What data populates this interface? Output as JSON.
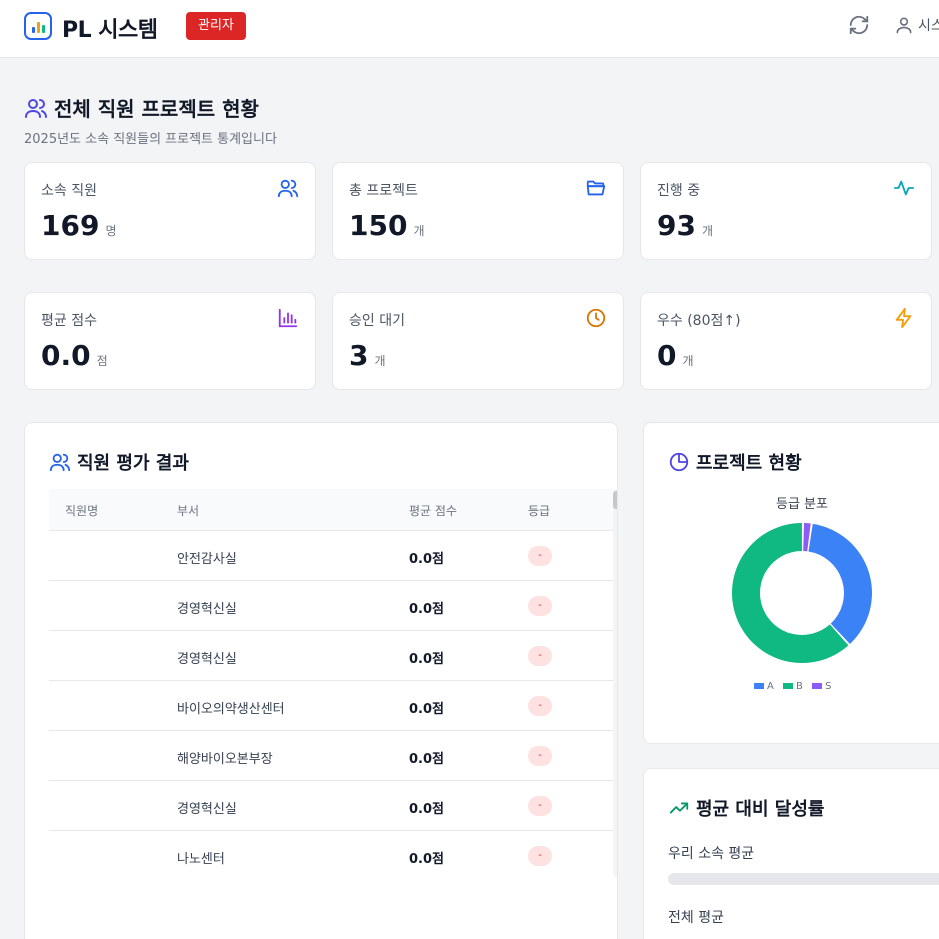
{
  "header": {
    "app_title": "PL 시스템",
    "role_badge": "관리자",
    "user_label": "시스"
  },
  "page": {
    "title": "전체 직원 프로젝트 현황",
    "subtitle": "2025년도 소속 직원들의 프로젝트 통계입니다"
  },
  "stats": [
    {
      "label": "소속 직원",
      "value": "169",
      "unit": "명",
      "icon": "users-icon",
      "color": "#2563eb"
    },
    {
      "label": "총 프로젝트",
      "value": "150",
      "unit": "개",
      "icon": "folder-icon",
      "color": "#2563eb"
    },
    {
      "label": "진행 중",
      "value": "93",
      "unit": "개",
      "icon": "activity-icon",
      "color": "#0ea5b7"
    },
    {
      "label": "평균 점수",
      "value": "0.0",
      "unit": "점",
      "icon": "bar-chart-icon",
      "color": "#9333ea"
    },
    {
      "label": "승인 대기",
      "value": "3",
      "unit": "개",
      "icon": "clock-icon",
      "color": "#d97706"
    },
    {
      "label": "우수 (80점↑)",
      "value": "0",
      "unit": "개",
      "icon": "lightning-icon",
      "color": "#f59e0b"
    }
  ],
  "evaluation": {
    "title": "직원 평가 결과",
    "columns": [
      "직원명",
      "부서",
      "평균 점수",
      "등급"
    ],
    "rows": [
      {
        "name": "",
        "dept": "안전감사실",
        "score": "0.0점",
        "grade": "-"
      },
      {
        "name": "",
        "dept": "경영혁신실",
        "score": "0.0점",
        "grade": "-"
      },
      {
        "name": "",
        "dept": "경영혁신실",
        "score": "0.0점",
        "grade": "-"
      },
      {
        "name": "",
        "dept": "바이오의약생산센터",
        "score": "0.0점",
        "grade": "-"
      },
      {
        "name": "",
        "dept": "해양바이오본부장",
        "score": "0.0점",
        "grade": "-"
      },
      {
        "name": "",
        "dept": "경영혁신실",
        "score": "0.0점",
        "grade": "-"
      },
      {
        "name": "",
        "dept": "나노센터",
        "score": "0.0점",
        "grade": "-"
      }
    ]
  },
  "project_status": {
    "title": "프로젝트 현황"
  },
  "chart_data": {
    "type": "pie",
    "title": "등급 분포",
    "categories": [
      "A",
      "B",
      "S"
    ],
    "values": [
      36,
      62,
      2
    ],
    "colors": [
      "#3b82f6",
      "#10b981",
      "#8b5cf6"
    ],
    "legend": "bottom"
  },
  "achievement": {
    "title": "평균 대비 달성률",
    "items": [
      {
        "label": "우리 소속 평균",
        "percent": 0
      },
      {
        "label": "전체 평균",
        "percent": 0
      }
    ]
  }
}
